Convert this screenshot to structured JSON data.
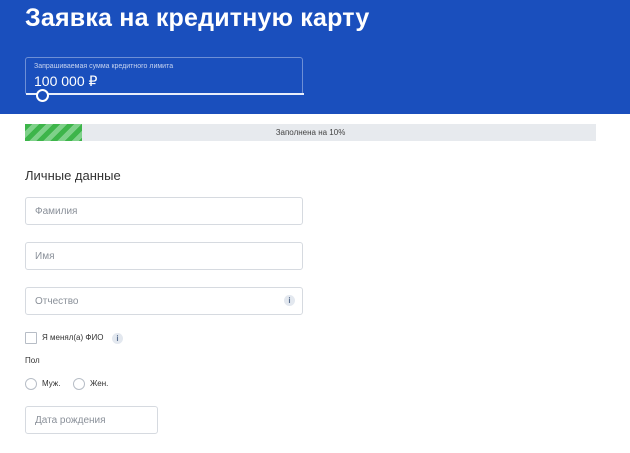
{
  "header": {
    "title": "Заявка на кредитную карту",
    "limit_caption": "Запрашиваемая сумма кредитного лимита",
    "limit_value": "100 000 ₽"
  },
  "progress": {
    "label": "Заполнена на 10%",
    "percent": 10
  },
  "personal": {
    "title": "Личные данные",
    "surname_placeholder": "Фамилия",
    "name_placeholder": "Имя",
    "patronymic_placeholder": "Отчество",
    "changed_name_label": "Я менял(а) ФИО",
    "gender_label": "Пол",
    "gender_male": "Муж.",
    "gender_female": "Жен.",
    "birthdate_placeholder": "Дата рождения"
  },
  "icons": {
    "info": "i"
  },
  "colors": {
    "header_bg": "#1a4fbd",
    "progress_fill": "#3db54a"
  }
}
